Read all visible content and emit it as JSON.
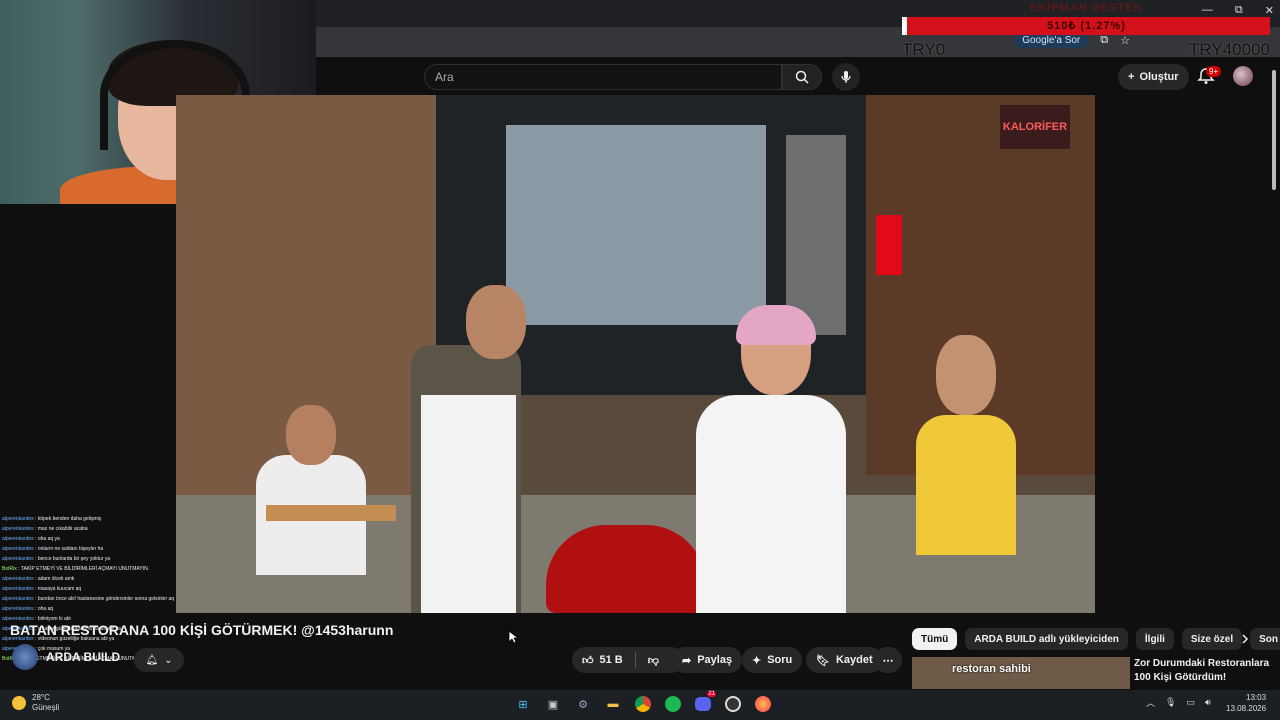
{
  "donation": {
    "title": "EKİPMAN DESTEK",
    "bar_text": "510₺ (1.27%)",
    "progress_percent": 1.27,
    "left_label": "TRY0",
    "right_label": "TRY40000"
  },
  "browser": {
    "google_ask": "Google'a Sor",
    "win_minimize": "—",
    "win_restore": "⧉",
    "win_close": "✕"
  },
  "youtube": {
    "search_placeholder": "Ara",
    "create_label": "Oluştur",
    "notifications_badge": "9+"
  },
  "video": {
    "title": "BATAN RESTORANA 100 KİŞİ GÖTÜRMEK! @1453harunn",
    "sign_text": "KALORİFER",
    "channel_name": "ARDA BUILD",
    "like_count": "51 B",
    "share_label": "Paylaş",
    "ask_label": "Soru",
    "save_label": "Kaydet"
  },
  "filters": {
    "chips": [
      "Tümü",
      "ARDA BUILD adlı yükleyiciden",
      "İlgili",
      "Size özel",
      "Son"
    ]
  },
  "recommendation": {
    "thumb_label": "restoran sahibi",
    "title": "Zor Durumdaki Restoranlara 100 Kişi Götürdüm!"
  },
  "chat": [
    {
      "user": "alperenkardes",
      "msg": "köpek benden daha gelişmiş",
      "bot": false
    },
    {
      "user": "alperenkardes",
      "msg": "max ne cıkabilir acaba",
      "bot": false
    },
    {
      "user": "alperenkardes",
      "msg": "oha aq ya",
      "bot": false
    },
    {
      "user": "alperenkardes",
      "msg": "onların ne saldanı bişeyler ha",
      "bot": false
    },
    {
      "user": "alperenkardes",
      "msg": "bence bunlarda bir şey yoktur ya",
      "bot": false
    },
    {
      "user": "BotRix",
      "msg": "TAKİP ETMEYİ VE BİLDİRİMLERİ AÇMAYI UNUTMAYIN.",
      "bot": true
    },
    {
      "user": "alperenkardes",
      "msg": "adam ölcek amk",
      "bot": false
    },
    {
      "user": "alperenkardes",
      "msg": "masaya kuucam aq",
      "bot": false
    },
    {
      "user": "alperenkardes",
      "msg": "bundan önce aki! hastanesine göndersinler sonra gelsinler aq",
      "bot": false
    },
    {
      "user": "alperenkardes",
      "msg": "oha aq",
      "bot": false
    },
    {
      "user": "alperenkardes",
      "msg": "bilmiyom ki abi",
      "bot": false
    },
    {
      "user": "alperenkardes",
      "msg": "o kadar güzel bi adam ki harun abi ya",
      "bot": false
    },
    {
      "user": "alperenkardes",
      "msg": "videonun güzelliğe baksana abi ya",
      "bot": false
    },
    {
      "user": "alperenkardes",
      "msg": "çok masum ya",
      "bot": false
    },
    {
      "user": "BotRix",
      "msg": "TAKİP ETMEYİ VE BİLDİRİMLERİ AÇMAYI UNUTMAYIN.",
      "bot": true
    }
  ],
  "taskbar": {
    "temperature": "28°C",
    "weather": "Güneşli",
    "time": "13:03",
    "date": "13.08.2026",
    "discord_badge": "21"
  },
  "colors": {
    "donation_bar": "#d4101b",
    "yt_bg": "#0f0f0f",
    "chip_active": "#f1f1f1",
    "notif_badge": "#cc0000"
  }
}
